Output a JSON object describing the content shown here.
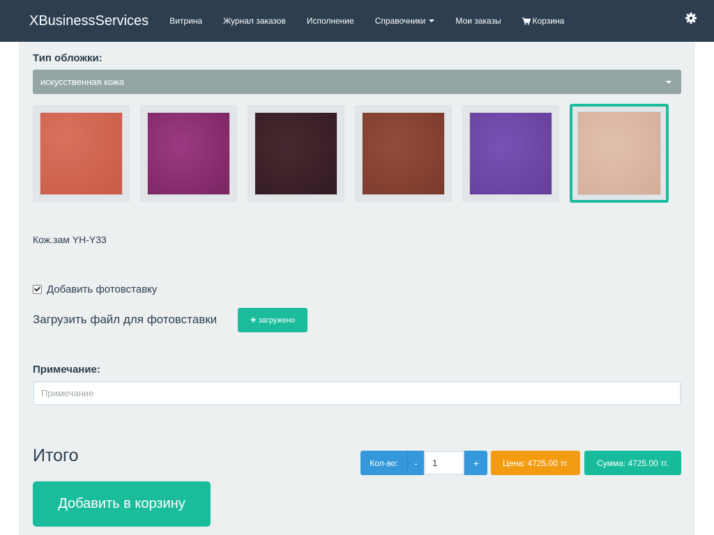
{
  "navbar": {
    "brand": "XBusinessServices",
    "items": [
      {
        "label": "Витрина"
      },
      {
        "label": "Журнал заказов"
      },
      {
        "label": "Исполнение"
      },
      {
        "label": "Справочники"
      },
      {
        "label": "Мои заказы"
      },
      {
        "label": "Корзина"
      }
    ],
    "settings_icon": "gear-icon",
    "cart_icon": "cart-icon"
  },
  "cover": {
    "label": "Тип обложки:",
    "selected_type": "искусственная кожа",
    "swatches": [
      {
        "color": "#d0634e",
        "selected": false
      },
      {
        "color": "#8c2e72",
        "selected": false
      },
      {
        "color": "#3c2229",
        "selected": false
      },
      {
        "color": "#8a4232",
        "selected": false
      },
      {
        "color": "#6f47a8",
        "selected": false
      },
      {
        "color": "#dcb7a3",
        "selected": true
      }
    ],
    "selected_name": "Кож.зам YH-Y33"
  },
  "photo_insert": {
    "checkbox_label": "Добавить фотовставку",
    "checked": true,
    "upload_label": "Загрузить файл для фотовставки",
    "upload_button": "загружено"
  },
  "comment": {
    "label": "Примечание:",
    "placeholder": "Примечание",
    "value": ""
  },
  "total": {
    "title": "Итого",
    "qty_label": "Кол-во:",
    "minus": "-",
    "plus": "+",
    "qty_value": "1",
    "price": "Цена: 4725.00 тг.",
    "sum": "Сумма: 4725.00 тг."
  },
  "add_to_cart": "Добавить в корзину",
  "colors": {
    "navbar": "#2c3e50",
    "accent": "#1abc9c",
    "primary": "#3498db",
    "warning": "#f39c12"
  }
}
